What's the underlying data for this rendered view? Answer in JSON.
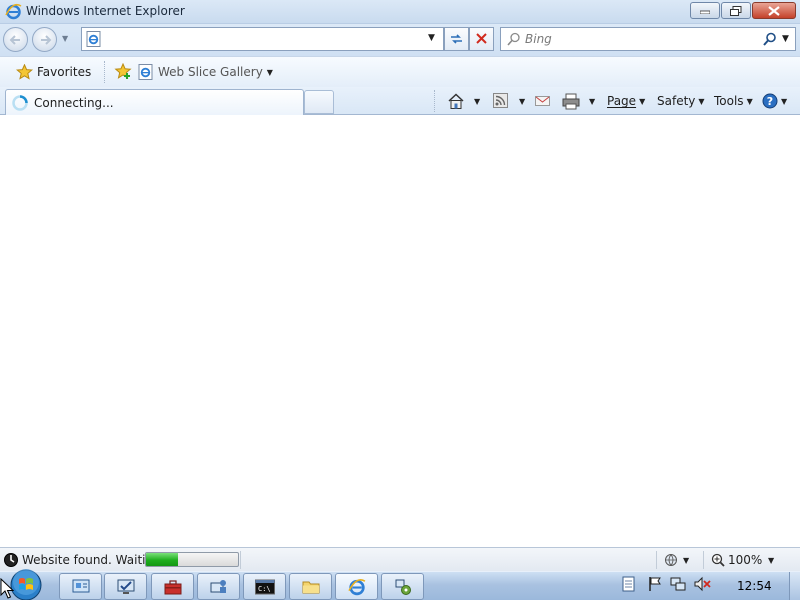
{
  "window": {
    "title": "Windows Internet Explorer",
    "controls": {
      "minimize": "minimize",
      "restore": "restore",
      "close": "close"
    }
  },
  "navigation": {
    "back_icon": "back-arrow-icon",
    "forward_icon": "forward-arrow-icon",
    "address": {
      "value": "",
      "page_icon": "ie-page-icon"
    },
    "refresh_icon": "refresh-icon",
    "stop_icon": "stop-icon",
    "search": {
      "placeholder": "Bing",
      "value": ""
    }
  },
  "favorites_bar": {
    "favorites_label": "Favorites",
    "items": [
      {
        "label": "Web Slice Gallery"
      }
    ]
  },
  "tabs": [
    {
      "label": "Connecting...",
      "active": true
    }
  ],
  "command_bar": {
    "items": [
      {
        "label": "Page"
      },
      {
        "label": "Safety"
      },
      {
        "label": "Tools"
      }
    ]
  },
  "status_bar": {
    "text": "Website found. Waitin",
    "progress": 0.35,
    "zoom": "100%"
  },
  "taskbar": {
    "clock": "12:54",
    "buttons": [
      {
        "icon": "network-window-icon"
      },
      {
        "icon": "monitor-check-icon"
      },
      {
        "icon": "toolbox-icon"
      },
      {
        "icon": "computer-user-icon"
      },
      {
        "icon": "command-prompt-icon"
      },
      {
        "icon": "folder-icon"
      },
      {
        "icon": "internet-explorer-icon"
      },
      {
        "icon": "network-settings-icon"
      }
    ],
    "command_prompt_label": "C:\\"
  },
  "colors": {
    "chrome_blue": "#d9e7f6",
    "progress_green": "#1fae1f",
    "close_red": "#c4412a"
  }
}
